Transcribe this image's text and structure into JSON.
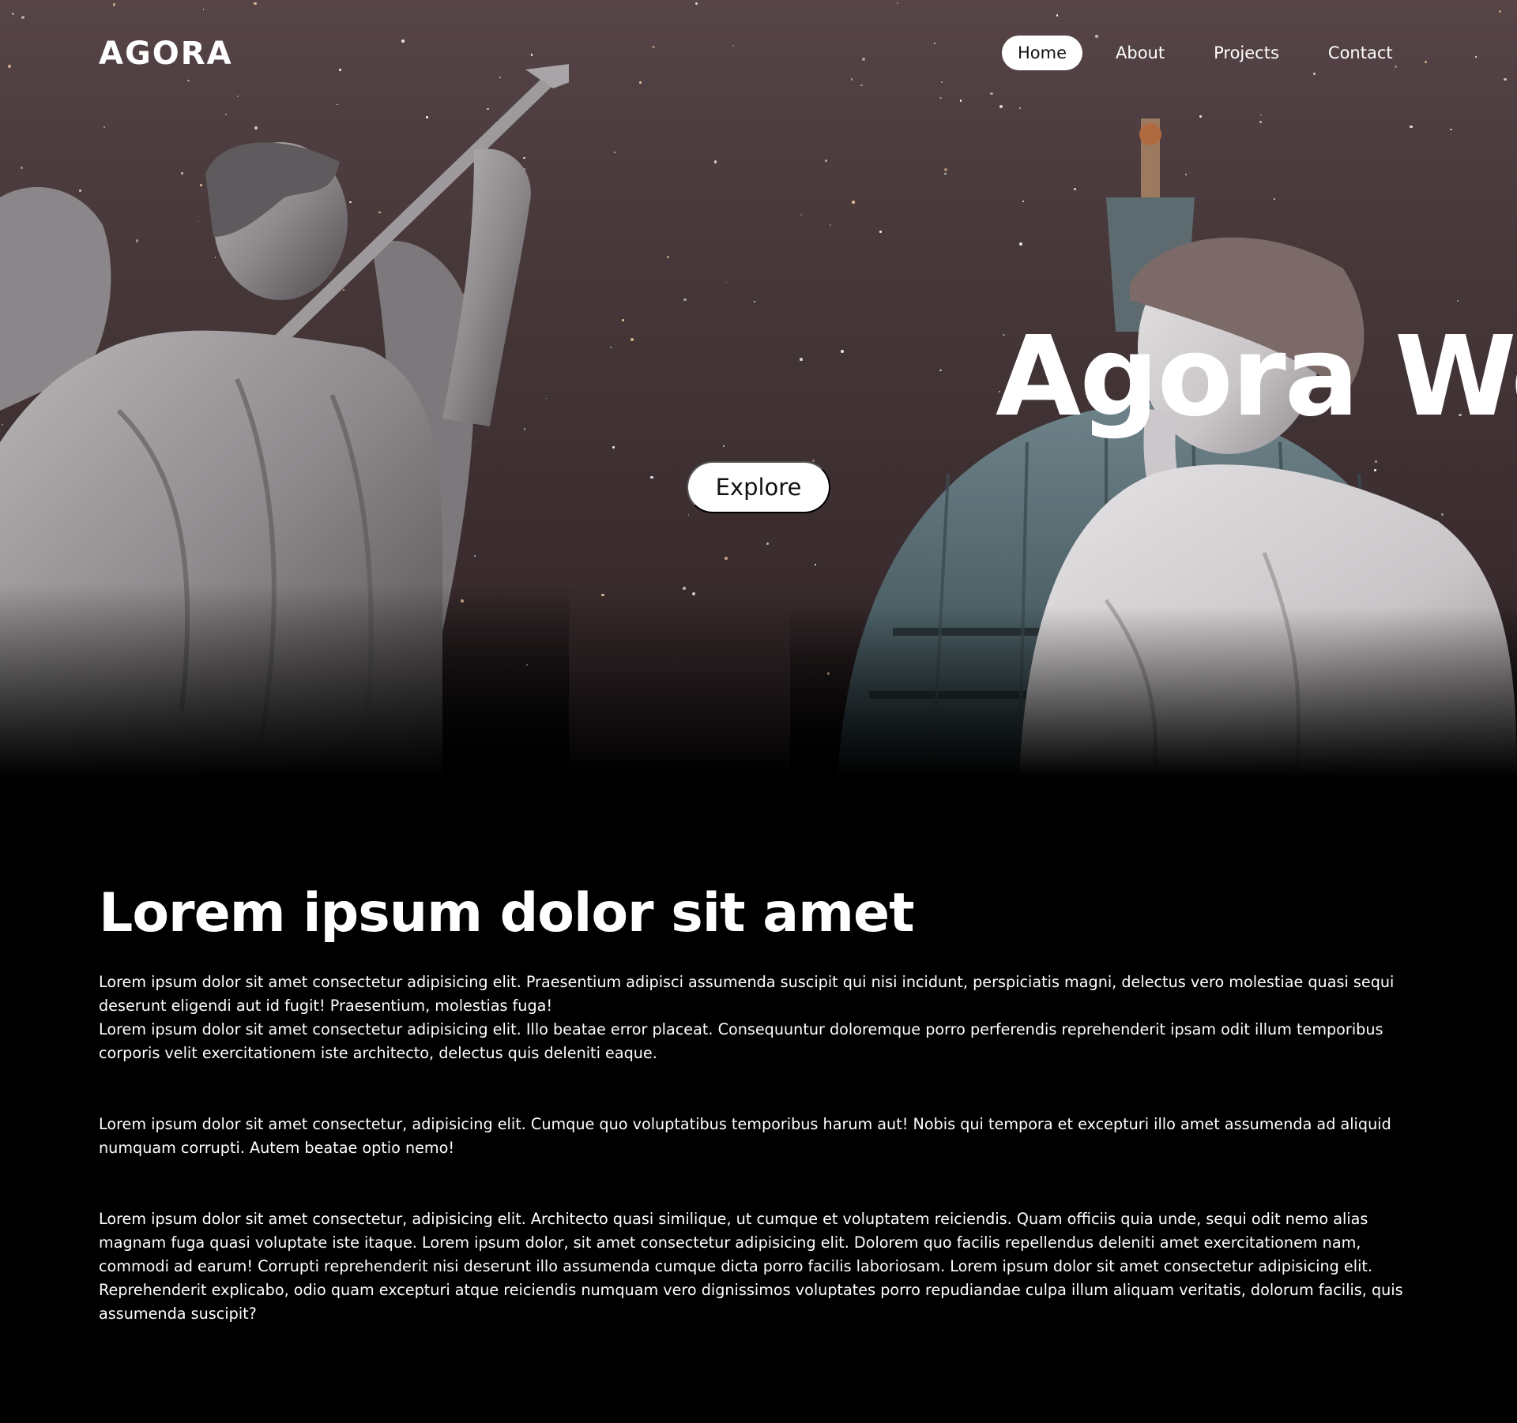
{
  "nav": {
    "logo": "AGORA",
    "links": [
      {
        "label": "Home",
        "active": true
      },
      {
        "label": "About",
        "active": false
      },
      {
        "label": "Projects",
        "active": false
      },
      {
        "label": "Contact",
        "active": false
      }
    ]
  },
  "hero": {
    "title": "Agora We",
    "explore_label": "Explore",
    "background_color": "#463739"
  },
  "content": {
    "heading": "Lorem ipsum dolor sit amet",
    "paragraphs": [
      {
        "lines": [
          "Lorem ipsum dolor sit amet consectetur adipisicing elit. Praesentium adipisci assumenda suscipit qui nisi incidunt, perspiciatis magni, delectus vero molestiae quasi sequi deserunt eligendi aut id fugit! Praesentium, molestias fuga!",
          "Lorem ipsum dolor sit amet consectetur adipisicing elit. Illo beatae error placeat. Consequuntur doloremque porro perferendis reprehenderit ipsam odit illum temporibus corporis velit exercitationem iste architecto, delectus quis deleniti eaque."
        ]
      },
      {
        "lines": [
          "Lorem ipsum dolor sit amet consectetur, adipisicing elit. Cumque quo voluptatibus temporibus harum aut! Nobis qui tempora et excepturi illo amet assumenda ad aliquid numquam corrupti. Autem beatae optio nemo!"
        ]
      },
      {
        "lines": [
          "Lorem ipsum dolor sit amet consectetur, adipisicing elit. Architecto quasi similique, ut cumque et voluptatem reiciendis. Quam officiis quia unde, sequi odit nemo alias magnam fuga quasi voluptate iste itaque. Lorem ipsum dolor, sit amet consectetur adipisicing elit. Dolorem quo facilis repellendus deleniti amet exercitationem nam, commodi ad earum! Corrupti reprehenderit nisi deserunt illo assumenda cumque dicta porro facilis laboriosam. Lorem ipsum dolor sit amet consectetur adipisicing elit. Reprehenderit explicabo, odio quam excepturi atque reiciendis numquam vero dignissimos voluptates porro repudiandae culpa illum aliquam veritatis, dolorum facilis, quis assumenda suscipit?"
        ]
      }
    ]
  },
  "decor": {
    "images": [
      "angel-statue",
      "cathedral-dome",
      "thinking-woman-statue"
    ]
  }
}
